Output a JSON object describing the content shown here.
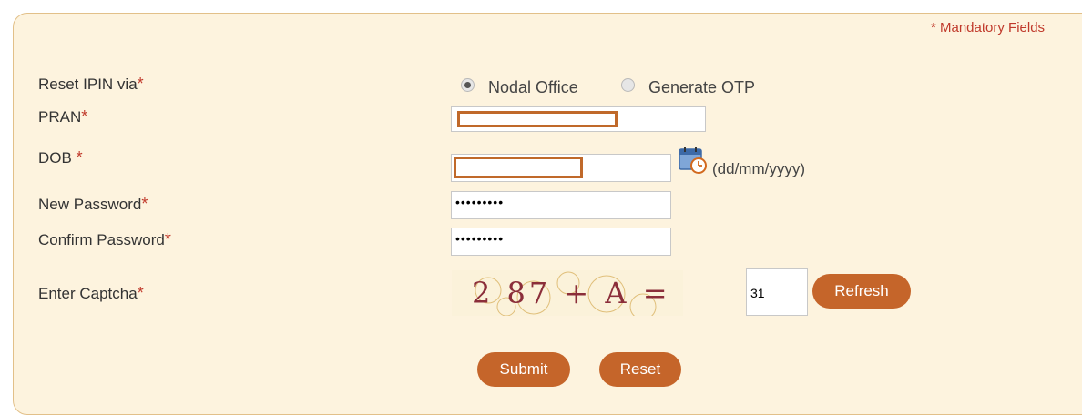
{
  "form": {
    "mandatory_note": "* Mandatory Fields",
    "fields": {
      "reset_via": {
        "label": "Reset IPIN via",
        "star": "*"
      },
      "pran": {
        "label": "PRAN",
        "star": "*"
      },
      "dob": {
        "label": "DOB ",
        "star": "*",
        "format_hint": "(dd/mm/yyyy)"
      },
      "new_password": {
        "label": "New Password",
        "star": "*",
        "value": "•••••••••"
      },
      "confirm_password": {
        "label": "Confirm Password",
        "star": "*",
        "value": "•••••••••"
      },
      "captcha": {
        "label": "Enter Captcha",
        "star": "*",
        "image_text": "2 87 + A =",
        "answer": "31"
      }
    },
    "reset_options": [
      {
        "label": "Nodal Office",
        "selected": true
      },
      {
        "label": "Generate OTP",
        "selected": false
      }
    ],
    "buttons": {
      "refresh": "Refresh",
      "submit": "Submit",
      "reset": "Reset"
    }
  },
  "colors": {
    "panel_bg": "#fdf3de",
    "panel_border": "#e2c089",
    "accent_button": "#c5652a",
    "required_star": "#c0392b",
    "redaction": "#c0692a"
  },
  "icons": {
    "calendar": "calendar-icon"
  }
}
